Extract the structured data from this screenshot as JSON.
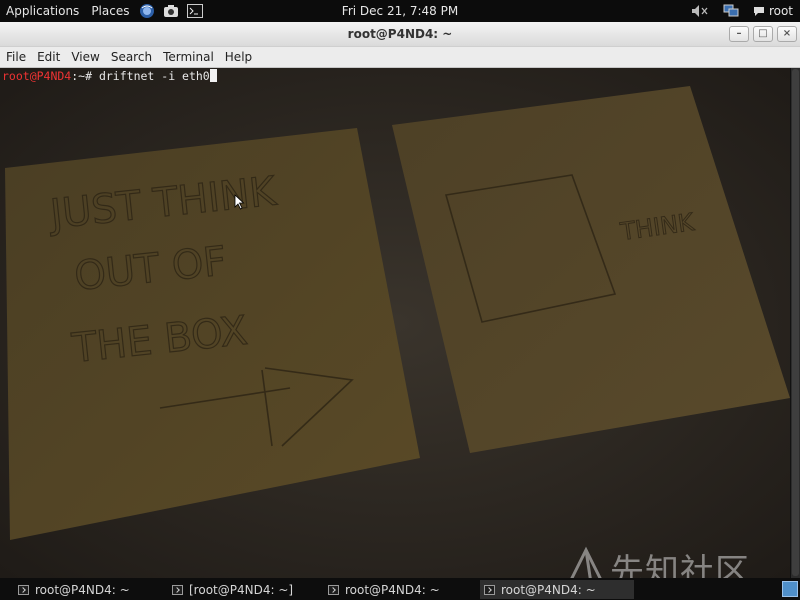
{
  "top_panel": {
    "applications": "Applications",
    "places": "Places",
    "launchers": [
      "browser-icon",
      "screenshot-icon",
      "terminal-icon"
    ],
    "clock": "Fri Dec 21,  7:48 PM",
    "user": "root",
    "tray_icons": [
      "volume-muted-icon",
      "network-icon",
      "chat-bubble-icon"
    ]
  },
  "window": {
    "title": "root@P4ND4: ~",
    "controls": {
      "minimize": "–",
      "maximize": "□",
      "close": "×"
    },
    "menu": [
      "File",
      "Edit",
      "View",
      "Search",
      "Terminal",
      "Help"
    ]
  },
  "terminal": {
    "prompt_user": "root@P4ND4",
    "prompt_path": ":~# ",
    "command": "driftnet -i eth0"
  },
  "wallpaper_note_left": [
    "JUST THINK",
    "OUT OF",
    "THE BOX"
  ],
  "wallpaper_note_right": "THINK",
  "watermark": "先知社区",
  "taskbar": {
    "tasks": [
      {
        "label": "root@P4ND4: ~"
      },
      {
        "label": "[root@P4ND4: ~]"
      },
      {
        "label": "root@P4ND4: ~"
      },
      {
        "label": "root@P4ND4: ~"
      }
    ]
  }
}
